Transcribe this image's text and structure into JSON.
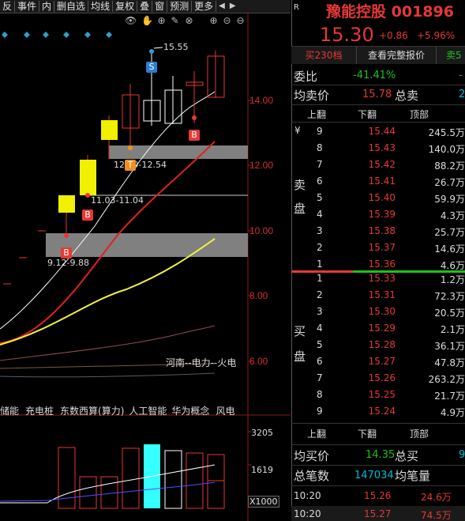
{
  "toolbar": {
    "items": [
      "反",
      "事件",
      "内",
      "删自选",
      "均线",
      "复权",
      "叠",
      "窗",
      "预测",
      "更多"
    ],
    "prev_label": "◀",
    "next_label": "▶"
  },
  "chart": {
    "price_labels": [
      "14.00",
      "12.00",
      "10.00",
      "8.00",
      "6.00"
    ],
    "high_label": "15.55",
    "zone_labels": [
      "12.79-12.54",
      "11.03-11.04",
      "9.12-9.88"
    ],
    "sector_label": "河南--电力--火电",
    "concepts": [
      "储能",
      "充电桩",
      "东数西算(算力)",
      "人工智能",
      "华为概念",
      "风电"
    ],
    "buy_marker": "B",
    "sell_marker": "S",
    "t_marker": "T",
    "volume_labels": [
      "3205",
      "1619"
    ],
    "volume_unit": "X1000"
  },
  "quote": {
    "r_label": "R",
    "name": "豫能控股",
    "code": "001896",
    "price": "15.30",
    "change": "+0.86",
    "change_pct": "+5.96%",
    "tabs": [
      "买230档",
      "查看完整报价",
      "卖5"
    ],
    "weibi_label": "委比",
    "weibi_value": "-41.41%",
    "weibi_extra": "-",
    "avg_sell_label": "均卖价",
    "avg_sell_value": "15.78",
    "total_sell_label": "总卖",
    "total_sell_value": "2",
    "ask_header": [
      "上翻",
      "下翻",
      "顶部"
    ],
    "ask_side_label": [
      "卖",
      "盘"
    ],
    "yen": "¥",
    "asks": [
      {
        "lv": "9",
        "price": "15.44",
        "vol": "245.5万"
      },
      {
        "lv": "8",
        "price": "15.43",
        "vol": "140.0万"
      },
      {
        "lv": "7",
        "price": "15.42",
        "vol": "88.2万"
      },
      {
        "lv": "6",
        "price": "15.41",
        "vol": "26.7万"
      },
      {
        "lv": "5",
        "price": "15.40",
        "vol": "59.9万"
      },
      {
        "lv": "4",
        "price": "15.39",
        "vol": "4.3万"
      },
      {
        "lv": "3",
        "price": "15.38",
        "vol": "25.7万"
      },
      {
        "lv": "2",
        "price": "15.37",
        "vol": "14.6万"
      },
      {
        "lv": "1",
        "price": "15.36",
        "vol": "4.6万"
      }
    ],
    "bid_side_label": [
      "买",
      "盘"
    ],
    "bids": [
      {
        "lv": "1",
        "price": "15.33",
        "vol": "1.2万"
      },
      {
        "lv": "2",
        "price": "15.31",
        "vol": "72.3万"
      },
      {
        "lv": "3",
        "price": "15.30",
        "vol": "20.5万"
      },
      {
        "lv": "4",
        "price": "15.29",
        "vol": "2.1万"
      },
      {
        "lv": "5",
        "price": "15.28",
        "vol": "36.1万"
      },
      {
        "lv": "6",
        "price": "15.27",
        "vol": "47.8万"
      },
      {
        "lv": "7",
        "price": "15.26",
        "vol": "263.2万"
      },
      {
        "lv": "8",
        "price": "15.25",
        "vol": "21.7万"
      },
      {
        "lv": "9",
        "price": "15.24",
        "vol": "4.9万"
      }
    ],
    "bid_header": [
      "上翻",
      "下翻",
      "顶部"
    ],
    "avg_buy_label": "均买价",
    "avg_buy_value": "14.35",
    "total_buy_label": "总买",
    "total_buy_value": "9",
    "total_trades_label": "总笔数",
    "total_trades_value": "147034",
    "avg_trade_label": "均笔量",
    "ticks": [
      {
        "time": "10:20",
        "price": "15.26",
        "vol": "24.6万"
      },
      {
        "time": "10:20",
        "price": "15.27",
        "vol": "74.5万"
      }
    ]
  },
  "colors": {
    "up": "#e53935",
    "down": "#19c419",
    "ma_white": "#ffffff",
    "ma_red": "#e02020",
    "ma_yellow": "#f0f040",
    "zone_gray": "#808080",
    "diamond": "#2a9fd6"
  }
}
